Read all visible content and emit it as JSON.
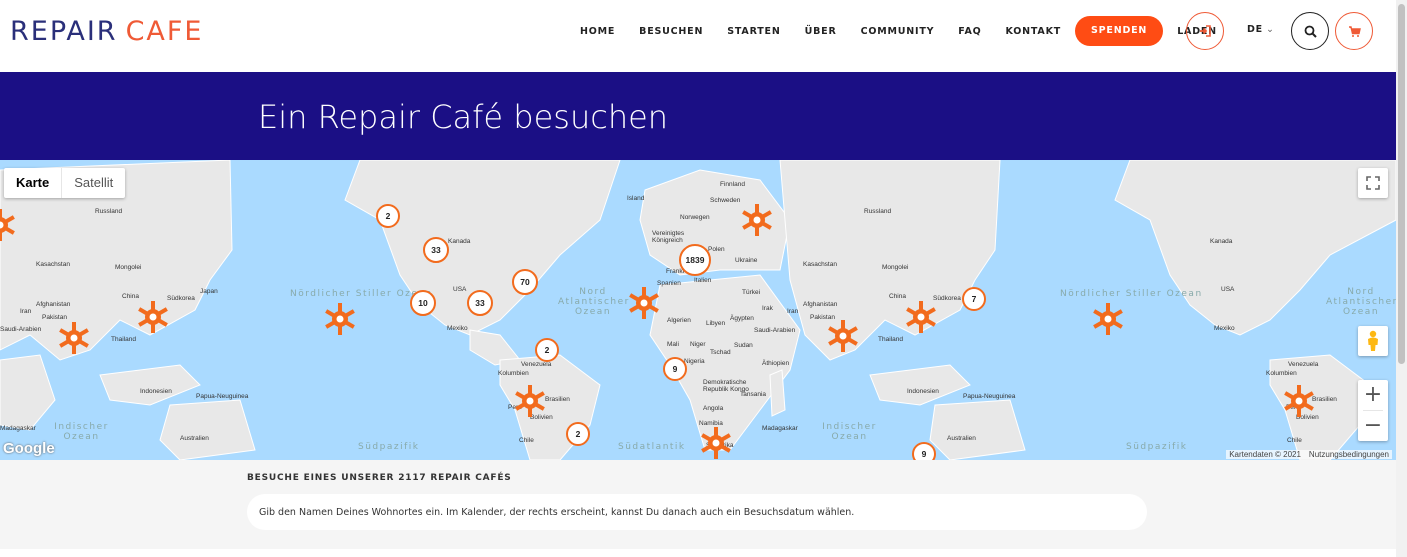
{
  "logo": {
    "part1": "REPAIR",
    "part2": "CAFE"
  },
  "nav": {
    "items": [
      "HOME",
      "BESUCHEN",
      "STARTEN",
      "ÜBER",
      "COMMUNITY",
      "FAQ",
      "KONTAKT"
    ],
    "donate": "SPENDEN",
    "shop": "LADEN",
    "lang": "DE",
    "lang_chevron": "⌄"
  },
  "banner": {
    "title": "Ein Repair Café besuchen"
  },
  "map": {
    "type_map": "Karte",
    "type_satellite": "Satellit",
    "google": "Google",
    "attribution": "Kartendaten © 2021",
    "terms": "Nutzungsbedingungen",
    "zoom_in": "+",
    "zoom_out": "−",
    "clusters": [
      "2",
      "33",
      "70",
      "10",
      "33",
      "1839",
      "2",
      "9",
      "2",
      "7",
      "9"
    ],
    "labels": [
      "Russland",
      "Kasachstan",
      "Mongolei",
      "China",
      "Japan",
      "Südkorea",
      "Iran",
      "Afghanistan",
      "Pakistan",
      "Thailand",
      "Indonesien",
      "Papua-Neuguinea",
      "Australien",
      "Kanada",
      "USA",
      "Mexiko",
      "Venezuela",
      "Kolumbien",
      "Brasilien",
      "Bolivien",
      "Peru",
      "Chile",
      "Island",
      "Finnland",
      "Schweden",
      "Norwegen",
      "Vereinigtes Königreich",
      "Polen",
      "Ukraine",
      "Frankreich",
      "Spanien",
      "Italien",
      "Türkei",
      "Irak",
      "Algerien",
      "Libyen",
      "Ägypten",
      "Saudi-Arabien",
      "Mali",
      "Niger",
      "Tschad",
      "Sudan",
      "Äthiopien",
      "Nigeria",
      "Demokratische Republik Kongo",
      "Tansania",
      "Angola",
      "Namibia",
      "Madagaskar",
      "Südafrika",
      "Russland",
      "Kasachstan",
      "Mongolei",
      "China",
      "Südkorea",
      "Afghanistan",
      "Pakistan",
      "Iran",
      "Thailand",
      "Indonesien",
      "Papua-Neuguinea",
      "Australien",
      "Kanada",
      "USA",
      "Mexiko",
      "Venezuela",
      "Kolumbien",
      "Brasilien",
      "Bolivien",
      "Peru",
      "Chile",
      "Saudi-Arabien",
      "Madagaskar"
    ],
    "oceans": [
      "Nördlicher Stiller Ozean",
      "Nord Atlantischer Ozean",
      "Indischer Ozean",
      "Südpazifik",
      "Südatlantik",
      "Indischer Ozean",
      "Nördlicher Stiller Ozean",
      "Nord Atlantischer Ozean",
      "Südpazifik"
    ]
  },
  "bottom": {
    "title": "BESUCHE EINES UNSERER 2117 REPAIR CAFÉS",
    "search_placeholder": "Gib den Namen Deines Wohnortes ein. Im Kalender, der rechts erscheint, kannst Du danach auch ein Besuchsdatum wählen."
  },
  "colors": {
    "brand_navy": "#2a2f7a",
    "brand_orange": "#ef5a36",
    "banner_bg": "#1b0f85",
    "donate_bg": "#ff4c14",
    "marker_orange": "#f26b1d"
  },
  "icons": {
    "login": "login-icon",
    "search": "search-icon",
    "cart": "cart-icon",
    "fullscreen": "fullscreen-icon",
    "pegman": "pegman-icon",
    "marker": "repair-cafe-gear-icon"
  }
}
